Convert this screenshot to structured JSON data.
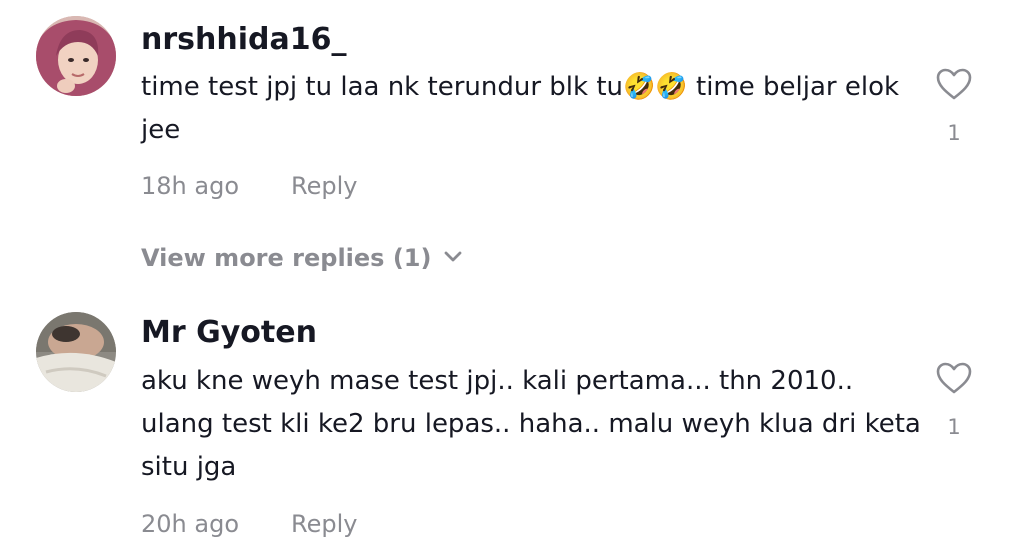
{
  "comments": [
    {
      "username": "nrshhida16_",
      "text": "time test jpj tu laa nk terundur blk tu🤣🤣 time beljar elok jee",
      "time": "18h ago",
      "reply_label": "Reply",
      "like_count": "1",
      "avatar": "profile-photo-avatar",
      "like_icon": "heart-outline-icon"
    },
    {
      "username": "Mr Gyoten",
      "text": "aku kne weyh mase test jpj.. kali pertama... thn 2010.. ulang test kli ke2 bru lepas.. haha.. malu weyh klua dri keta situ jga",
      "time": "20h ago",
      "reply_label": "Reply",
      "like_count": "1",
      "avatar": "profile-photo-avatar",
      "like_icon": "heart-outline-icon"
    }
  ],
  "view_more": {
    "label": "View more replies (1)",
    "icon": "chevron-down-icon"
  },
  "colors": {
    "primary_text": "#161823",
    "secondary_text": "#8a8b91",
    "background": "#ffffff"
  }
}
